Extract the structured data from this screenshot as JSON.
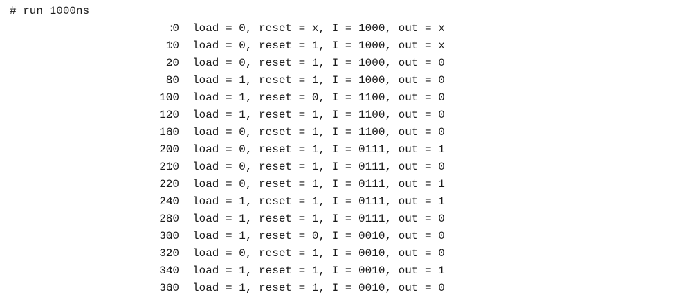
{
  "console": {
    "command": "# run 1000ns",
    "separator": ":",
    "rows": [
      {
        "time": "0",
        "text": "load = 0, reset = x, I = 1000, out = x"
      },
      {
        "time": "10",
        "text": "load = 0, reset = 1, I = 1000, out = x"
      },
      {
        "time": "20",
        "text": "load = 0, reset = 1, I = 1000, out = 0"
      },
      {
        "time": "80",
        "text": "load = 1, reset = 1, I = 1000, out = 0"
      },
      {
        "time": "100",
        "text": "load = 1, reset = 0, I = 1100, out = 0"
      },
      {
        "time": "120",
        "text": "load = 1, reset = 1, I = 1100, out = 0"
      },
      {
        "time": "160",
        "text": "load = 0, reset = 1, I = 1100, out = 0"
      },
      {
        "time": "200",
        "text": "load = 0, reset = 1, I = 0111, out = 1"
      },
      {
        "time": "210",
        "text": "load = 0, reset = 1, I = 0111, out = 0"
      },
      {
        "time": "220",
        "text": "load = 0, reset = 1, I = 0111, out = 1"
      },
      {
        "time": "240",
        "text": "load = 1, reset = 1, I = 0111, out = 1"
      },
      {
        "time": "280",
        "text": "load = 1, reset = 1, I = 0111, out = 0"
      },
      {
        "time": "300",
        "text": "load = 1, reset = 0, I = 0010, out = 0"
      },
      {
        "time": "320",
        "text": "load = 0, reset = 1, I = 0010, out = 0"
      },
      {
        "time": "340",
        "text": "load = 1, reset = 1, I = 0010, out = 1"
      },
      {
        "time": "360",
        "text": "load = 1, reset = 1, I = 0010, out = 0"
      }
    ]
  }
}
